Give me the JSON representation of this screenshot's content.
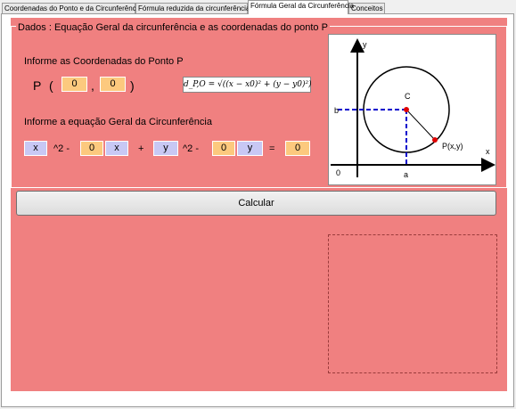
{
  "tabs": [
    {
      "label": "Coordenadas do Ponto e da Circunferência"
    },
    {
      "label": "Fórmula reduzida da circunferência"
    },
    {
      "label": "Fórmula Geral da Circunferência"
    },
    {
      "label": "Conceitos"
    }
  ],
  "group_title": "Dados : Equação Geral da circunferência e as coordenadas do ponto P",
  "point": {
    "heading": "Informe as Coordenadas do Ponto P",
    "name": "P",
    "open": "(",
    "comma": ",",
    "close": ")",
    "x0": "0",
    "y0": "0"
  },
  "distance_formula": "d_P,O = √((x − x0)² + (y − y0)²)",
  "equation": {
    "heading": "Informe a equação Geral da Circunferência",
    "x_var": "x",
    "pow1": "^2 -",
    "coef_x": "0",
    "x_var2": "x",
    "plus": "+",
    "y_var": "y",
    "pow2": "^2 -",
    "coef_y": "0",
    "y_var2": "y",
    "equals": "=",
    "rhs": "0"
  },
  "diagram_labels": {
    "y_axis": "y",
    "x_axis": "x",
    "center": "C",
    "point": "P(x,y)",
    "b": "b",
    "a": "a",
    "origin": "0"
  },
  "button_label": "Calcular",
  "colors": {
    "panel": "#f08080",
    "input_orange": "#fcc97e",
    "input_lavender": "#c8c8f4"
  }
}
